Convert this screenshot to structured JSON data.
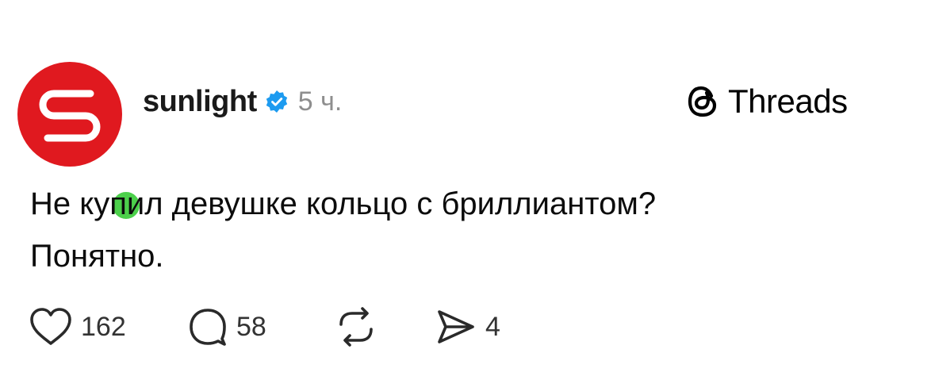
{
  "post": {
    "username": "sunlight",
    "time": "5 ч.",
    "verified": true,
    "brand": "Threads",
    "text_lines": [
      "Не купил девушке кольцо с бриллиантом?",
      "Понятно."
    ],
    "actions": {
      "likes": "162",
      "comments": "58",
      "shares": "4"
    }
  },
  "icons": {
    "avatar": "sunlight-logo-icon",
    "verified": "verified-badge-icon",
    "brand": "threads-logo-icon",
    "like": "heart-icon",
    "comment": "comment-bubble-icon",
    "repost": "repost-icon",
    "share": "send-icon"
  },
  "colors": {
    "brand_red": "#e0191f",
    "online_green": "#4cd04b",
    "verified_blue": "#1d9bf0",
    "muted_text": "#8e8e8e"
  }
}
